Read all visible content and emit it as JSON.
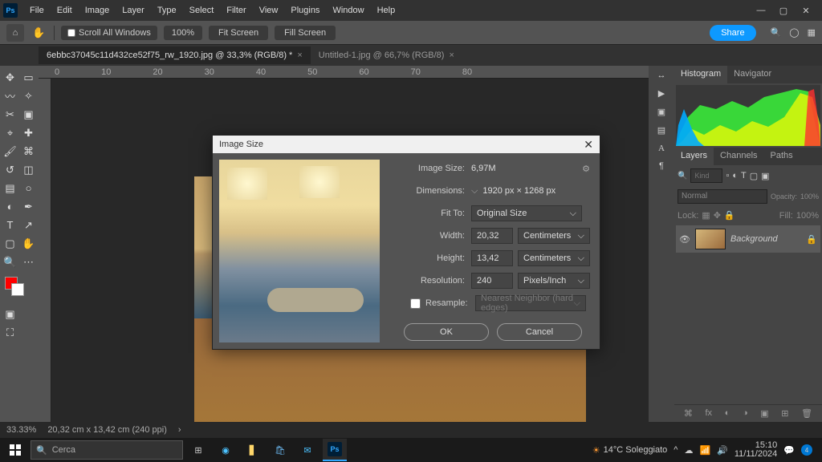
{
  "menubar": [
    "File",
    "Edit",
    "Image",
    "Layer",
    "Type",
    "Select",
    "Filter",
    "View",
    "Plugins",
    "Window",
    "Help"
  ],
  "optionsbar": {
    "scroll_all": "Scroll All Windows",
    "zoom_pct": "100%",
    "fit_screen": "Fit Screen",
    "fill_screen": "Fill Screen",
    "share": "Share"
  },
  "tabs": [
    {
      "label": "6ebbc37045c11d432ce52f75_rw_1920.jpg @ 33,3% (RGB/8) *",
      "active": true
    },
    {
      "label": "Untitled-1.jpg @ 66,7% (RGB/8)",
      "active": false
    }
  ],
  "ruler_ticks": [
    "0",
    "10",
    "20",
    "30",
    "40",
    "50",
    "60",
    "70",
    "80"
  ],
  "dialog": {
    "title": "Image Size",
    "image_size_lbl": "Image Size:",
    "image_size_val": "6,97M",
    "dimensions_lbl": "Dimensions:",
    "dimensions_val": "1920 px × 1268 px",
    "fit_to_lbl": "Fit To:",
    "fit_to_val": "Original Size",
    "width_lbl": "Width:",
    "width_val": "20,32",
    "height_lbl": "Height:",
    "height_val": "13,42",
    "unit_wh": "Centimeters",
    "resolution_lbl": "Resolution:",
    "resolution_val": "240",
    "unit_res": "Pixels/Inch",
    "resample_lbl": "Resample:",
    "resample_method": "Nearest Neighbor (hard edges)",
    "ok": "OK",
    "cancel": "Cancel"
  },
  "panels": {
    "histogram_tabs": [
      "Histogram",
      "Navigator"
    ],
    "layers_tabs": [
      "Layers",
      "Channels",
      "Paths"
    ],
    "blend_mode": "Normal",
    "opacity_lbl": "Opacity:",
    "opacity_val": "100%",
    "lock_lbl": "Lock:",
    "fill_lbl": "Fill:",
    "fill_val": "100%",
    "search_placeholder": "Kind",
    "bg_layer": "Background"
  },
  "statusbar": {
    "zoom": "33.33%",
    "docinfo": "20,32 cm x 13,42 cm (240 ppi)"
  },
  "taskbar": {
    "search_placeholder": "Cerca",
    "weather": "14°C Soleggiato",
    "time": "15:10",
    "date": "11/11/2024",
    "badge": "4"
  }
}
